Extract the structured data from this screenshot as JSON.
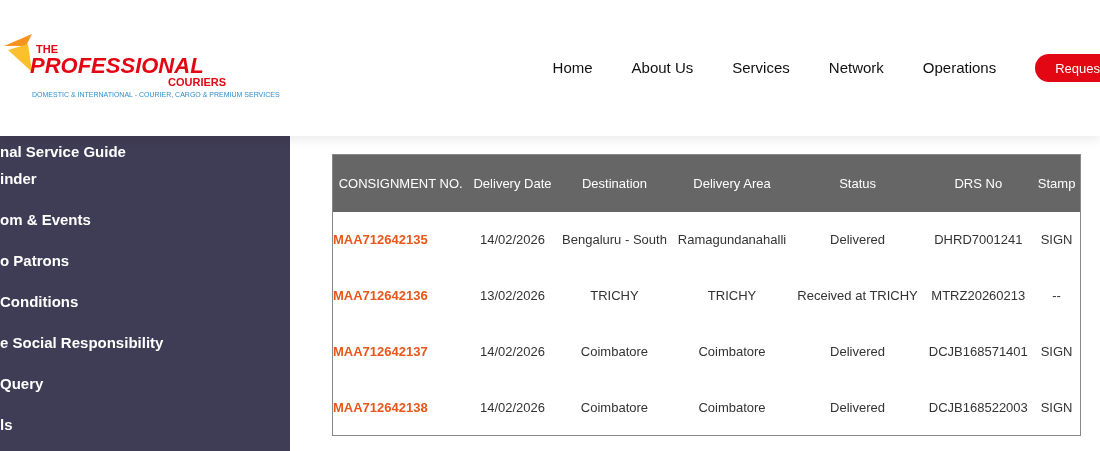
{
  "logo": {
    "line_1": "THE",
    "line_2": "PROFESSIONAL",
    "line_3": "COURIERS",
    "tagline": "DOMESTIC & INTERNATIONAL - COURIER, CARGO & PREMIUM SERVICES"
  },
  "nav": [
    "Home",
    "About Us",
    "Services",
    "Network",
    "Operations"
  ],
  "request_button": "Reques",
  "sidebar": {
    "items": [
      {
        "label": "nal Service Guide"
      },
      {
        "label": "inder"
      },
      {
        "label": "om & Events"
      },
      {
        "label": "o Patrons"
      },
      {
        "label": "Conditions"
      },
      {
        "label": "e Social Responsibility"
      },
      {
        "label": "Query"
      },
      {
        "label": "ls"
      }
    ]
  },
  "table": {
    "columns": [
      "CONSIGNMENT NO.",
      "Delivery Date",
      "Destination",
      "Delivery Area",
      "Status",
      "DRS No",
      "Stamp"
    ],
    "rows": [
      [
        "MAA712642135",
        "14/02/2026",
        "Bengaluru - South",
        "Ramagundanahalli",
        "Delivered",
        "DHRD7001241",
        "SIGN"
      ],
      [
        "MAA712642136",
        "13/02/2026",
        "TRICHY",
        "TRICHY",
        "Received at TRICHY",
        "MTRZ20260213",
        "--"
      ],
      [
        "MAA712642137",
        "14/02/2026",
        "Coimbatore",
        "Coimbatore",
        "Delivered",
        "DCJB168571401",
        "SIGN"
      ],
      [
        "MAA712642138",
        "14/02/2026",
        "Coimbatore",
        "Coimbatore",
        "Delivered",
        "DCJB168522003",
        "SIGN"
      ]
    ]
  }
}
